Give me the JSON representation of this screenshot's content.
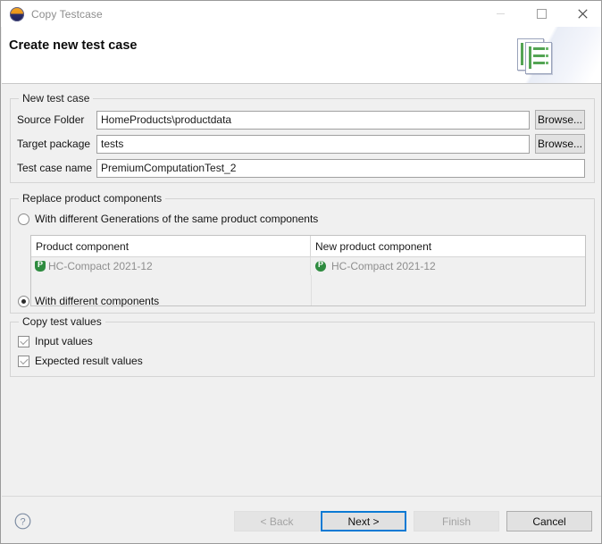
{
  "window": {
    "title": "Copy Testcase",
    "icon": "faktor-ips-icon",
    "controls": {
      "minimize": "minimize-icon",
      "maximize": "maximize-icon",
      "close": "close-icon"
    }
  },
  "header": {
    "title": "Create new test case",
    "artwork": "test-case-documents-icon"
  },
  "new_test_case": {
    "legend": "New test case",
    "fields": [
      {
        "label": "Source Folder",
        "value": "HomeProducts\\productdata",
        "browse": "Browse..."
      },
      {
        "label": "Target package",
        "value": "tests",
        "browse": "Browse..."
      },
      {
        "label": "Test case name",
        "value": "PremiumComputationTest_2"
      }
    ]
  },
  "replace_components": {
    "legend": "Replace product components",
    "radio_generations": {
      "label": "With different Generations of the same product components",
      "checked": false
    },
    "radio_components": {
      "label": "With different components",
      "checked": true
    },
    "table": {
      "columns": [
        "Product component",
        "New product component"
      ],
      "rows": [
        {
          "product_component": "HC-Compact 2021-12",
          "new_product_component": "HC-Compact 2021-12"
        }
      ]
    }
  },
  "copy_test_values": {
    "legend": "Copy test values",
    "checkboxes": [
      {
        "label": "Input values",
        "checked": true
      },
      {
        "label": "Expected result values",
        "checked": true
      }
    ]
  },
  "footer": {
    "help": "help-icon",
    "buttons": [
      {
        "label": "< Back",
        "state": "disabled"
      },
      {
        "label": "Next >",
        "state": "focused"
      },
      {
        "label": "Finish",
        "state": "disabled"
      },
      {
        "label": "Cancel",
        "state": "normal"
      }
    ]
  },
  "colors": {
    "accent": "#0a7ad4",
    "component_icon": "#2e8b3f",
    "window_bg": "#f0f0f0"
  }
}
